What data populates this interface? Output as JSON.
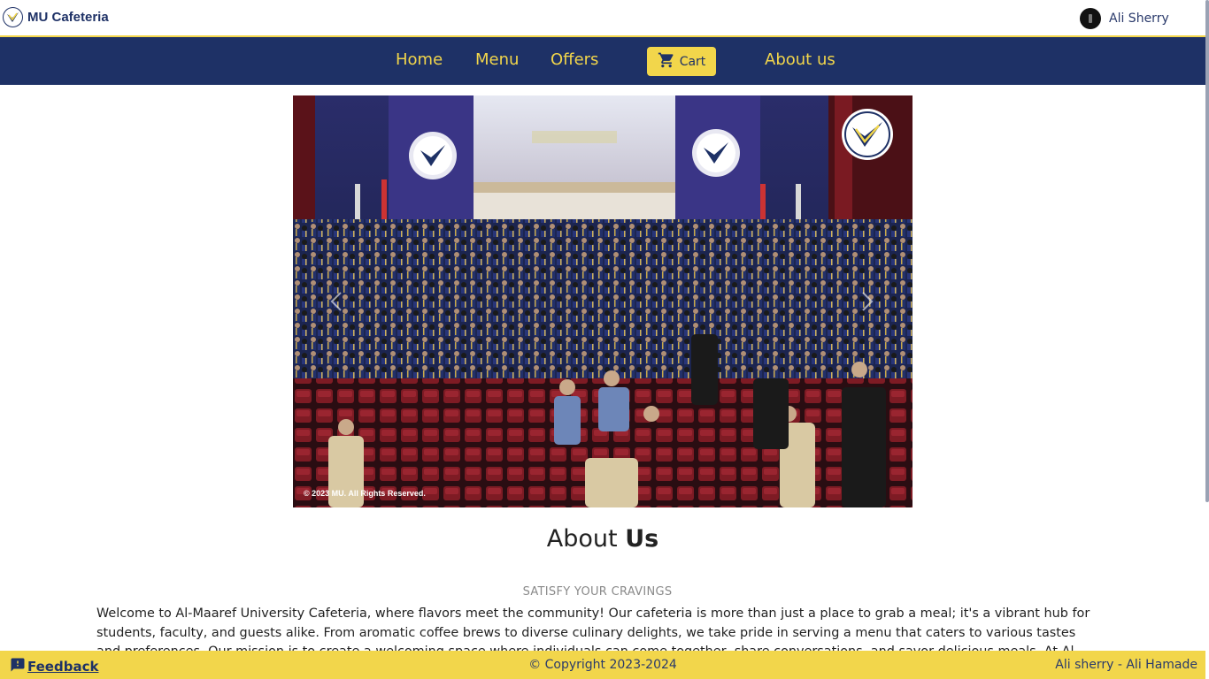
{
  "brand": {
    "name": "MU Cafeteria",
    "logo_icon": "mu-logo-icon"
  },
  "user": {
    "name": "Ali Sherry",
    "avatar_icon": "user-avatar-icon"
  },
  "nav": {
    "items": [
      {
        "label": "Home"
      },
      {
        "label": "Menu"
      },
      {
        "label": "Offers"
      },
      {
        "label": "About us"
      }
    ],
    "cart": {
      "label": "Cart",
      "icon": "cart-icon"
    }
  },
  "hero": {
    "alt": "Graduation ceremony photo",
    "copyright": "© 2023 MU. All Rights Reserved.",
    "prev_icon": "chevron-left-icon",
    "next_icon": "chevron-right-icon"
  },
  "about": {
    "title_light": "About",
    "title_bold": "Us",
    "tagline": "SATISFY YOUR CRAVINGS",
    "text": "Welcome to Al-Maaref University Cafeteria, where flavors meet the community! Our cafeteria is more than just a place to grab a meal; it's a vibrant hub for students, faculty, and guests alike. From aromatic coffee brews to diverse culinary delights, we take pride in serving a menu that caters to various tastes and preferences. Our mission is to create a welcoming space where individuals can come together, share conversations, and savor delicious meals. At Al-"
  },
  "footer": {
    "feedback_label": "Feedback",
    "feedback_icon": "feedback-icon",
    "copyright": "© Copyright 2023-2024",
    "authors": "Ali sherry - Ali Hamade"
  },
  "colors": {
    "navy": "#1e3166",
    "gold": "#f2d64b"
  }
}
